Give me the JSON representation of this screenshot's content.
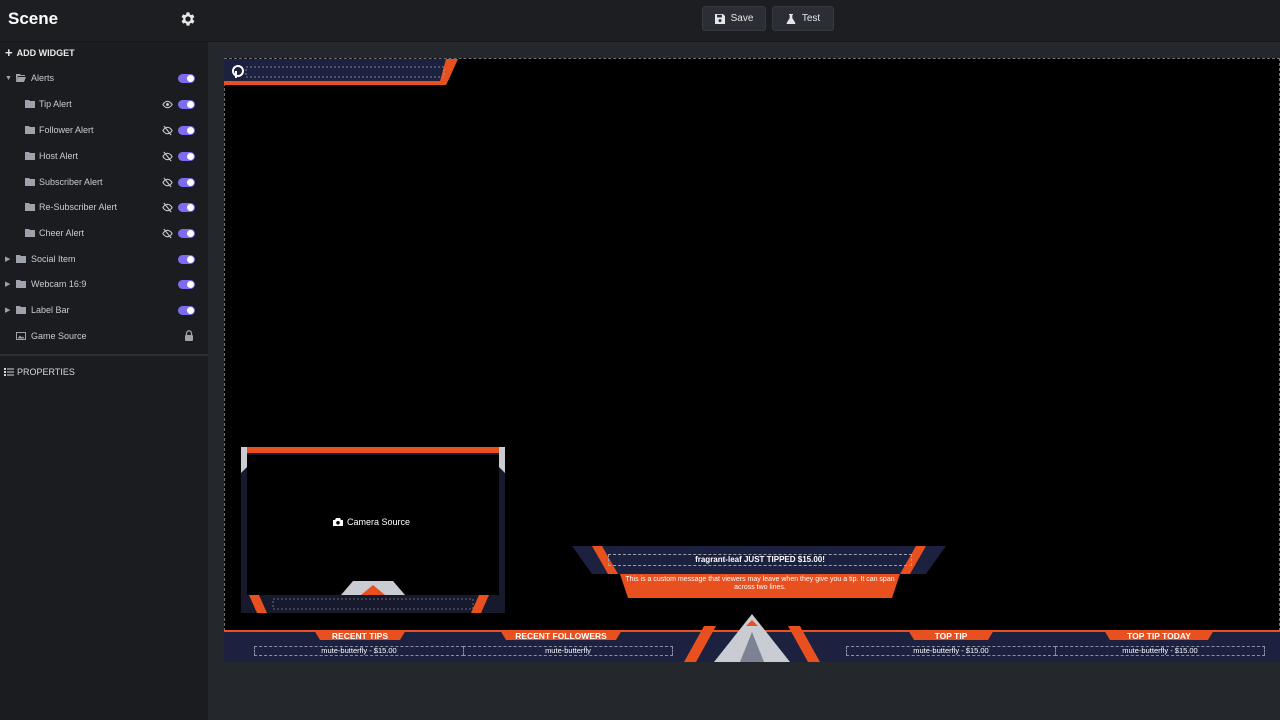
{
  "header": {
    "title": "Scene",
    "save_label": "Save",
    "test_label": "Test"
  },
  "sidebar": {
    "add_widget_label": "ADD WIDGET",
    "properties_label": "PROPERTIES",
    "items": [
      {
        "label": "Alerts"
      },
      {
        "label": "Tip Alert"
      },
      {
        "label": "Follower Alert"
      },
      {
        "label": "Host Alert"
      },
      {
        "label": "Subscriber Alert"
      },
      {
        "label": "Re-Subscriber Alert"
      },
      {
        "label": "Cheer Alert"
      },
      {
        "label": "Social Item"
      },
      {
        "label": "Webcam 16:9"
      },
      {
        "label": "Label Bar"
      },
      {
        "label": "Game Source"
      }
    ]
  },
  "canvas": {
    "camera_label": "Camera Source",
    "alert_title": "fragrant-leaf JUST TIPPED $15.00!",
    "alert_message": "This is a custom message that viewers may leave when they give you a tip. It can span across two lines.",
    "label_bar": [
      {
        "title": "RECENT TIPS",
        "value": "mute-butterfly - $15.00"
      },
      {
        "title": "RECENT FOLLOWERS",
        "value": "mute-butterfly"
      },
      {
        "title": "TOP TIP",
        "value": "mute-butterfly - $15.00"
      },
      {
        "title": "TOP TIP TODAY",
        "value": "mute-butterfly - $15.00"
      }
    ]
  },
  "colors": {
    "accent_toggle": "#7b6cf0",
    "overlay_orange": "#e8501f",
    "overlay_navy": "#1c2140"
  }
}
